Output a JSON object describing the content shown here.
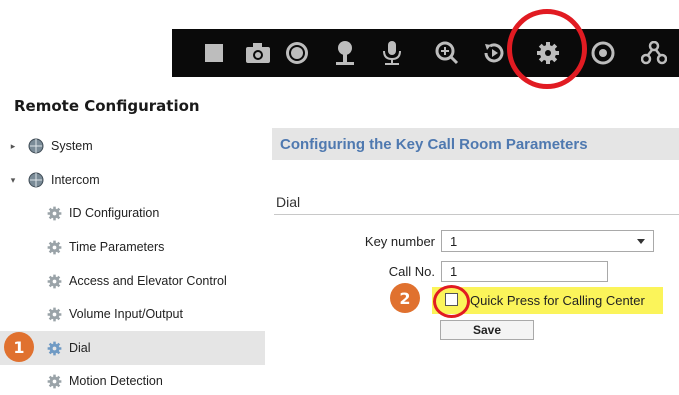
{
  "toolbar": {
    "buttons": [
      {
        "icon": "stop-square-icon"
      },
      {
        "icon": "camera-icon"
      },
      {
        "icon": "record-icon"
      },
      {
        "icon": "speaker-icon"
      },
      {
        "icon": "microphone-icon"
      },
      {
        "icon": "zoom-in-icon"
      },
      {
        "icon": "playback-icon"
      },
      {
        "icon": "gear-icon",
        "highlighted": true
      },
      {
        "icon": "target-icon"
      },
      {
        "icon": "network-icon"
      }
    ]
  },
  "page": {
    "title": "Remote Configuration"
  },
  "sidebar": {
    "items": [
      {
        "label": "System",
        "expanded": false,
        "level": 0
      },
      {
        "label": "Intercom",
        "expanded": true,
        "level": 0
      },
      {
        "label": "ID Configuration",
        "level": 1
      },
      {
        "label": "Time Parameters",
        "level": 1
      },
      {
        "label": "Access and Elevator Control",
        "level": 1
      },
      {
        "label": "Volume Input/Output",
        "level": 1
      },
      {
        "label": "Dial",
        "level": 1,
        "selected": true
      },
      {
        "label": "Motion Detection",
        "level": 1
      }
    ]
  },
  "badges": {
    "step1": "1",
    "step2": "2"
  },
  "panel": {
    "title": "Configuring the Key Call Room Parameters",
    "section": "Dial",
    "key_number_label": "Key number",
    "key_number_value": "1",
    "call_no_label": "Call No.",
    "call_no_value": "1",
    "quick_press_label": "Quick Press for Calling Center",
    "quick_press_checked": false,
    "save_label": "Save"
  },
  "colors": {
    "accent_title": "#4f79b0",
    "highlight_ring": "#e11b22",
    "badge": "#e0712f",
    "highlight_yellow": "#fbf45a",
    "selected_row": "#e5e5e5"
  }
}
